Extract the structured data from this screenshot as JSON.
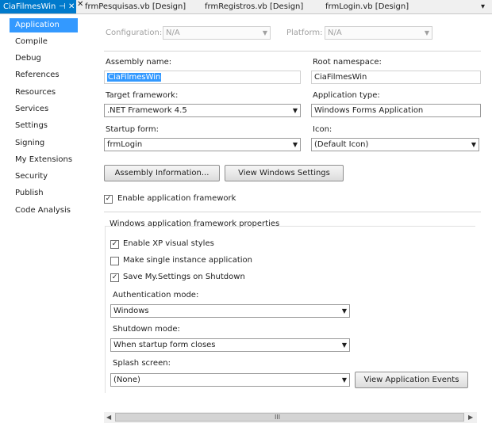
{
  "tabs": [
    {
      "label": "CiaFilmesWin",
      "pin": "⊣",
      "close": "✕"
    },
    {
      "label": "frmPesquisas.vb [Design]",
      "close": "✕"
    },
    {
      "label": "frmRegistros.vb [Design]"
    },
    {
      "label": "frmLogin.vb [Design]"
    }
  ],
  "tab_overflow": "▾",
  "sidebar": {
    "items": [
      {
        "label": "Application"
      },
      {
        "label": "Compile"
      },
      {
        "label": "Debug"
      },
      {
        "label": "References"
      },
      {
        "label": "Resources"
      },
      {
        "label": "Services"
      },
      {
        "label": "Settings"
      },
      {
        "label": "Signing"
      },
      {
        "label": "My Extensions"
      },
      {
        "label": "Security"
      },
      {
        "label": "Publish"
      },
      {
        "label": "Code Analysis"
      }
    ]
  },
  "config": {
    "label": "Configuration:",
    "value": "N/A",
    "platform_label": "Platform:",
    "platform_value": "N/A"
  },
  "assembly_name": {
    "label": "Assembly name:",
    "value": "CiaFilmesWin"
  },
  "root_namespace": {
    "label": "Root namespace:",
    "value": "CiaFilmesWin"
  },
  "target_framework": {
    "label": "Target framework:",
    "value": ".NET Framework 4.5"
  },
  "application_type": {
    "label": "Application type:",
    "value": "Windows Forms Application"
  },
  "startup_form": {
    "label": "Startup form:",
    "value": "frmLogin"
  },
  "icon": {
    "label": "Icon:",
    "value": "(Default Icon)"
  },
  "buttons": {
    "assembly_info": "Assembly Information...",
    "view_windows_settings": "View Windows Settings",
    "view_app_events": "View Application Events"
  },
  "enable_framework": {
    "label": "Enable application framework",
    "checked": true
  },
  "framework_props": {
    "title": "Windows application framework properties",
    "xp_styles": {
      "label": "Enable XP visual styles",
      "checked": true
    },
    "single_instance": {
      "label": "Make single instance application",
      "checked": false
    },
    "save_settings": {
      "label": "Save My.Settings on Shutdown",
      "checked": true
    },
    "auth_mode": {
      "label": "Authentication mode:",
      "value": "Windows"
    },
    "shutdown_mode": {
      "label": "Shutdown mode:",
      "value": "When startup form closes"
    },
    "splash": {
      "label": "Splash screen:",
      "value": "(None)"
    }
  },
  "check_glyph": "✓",
  "arrow_glyph": "▼",
  "scroll": {
    "left": "◀",
    "right": "▶",
    "grip": "III"
  }
}
